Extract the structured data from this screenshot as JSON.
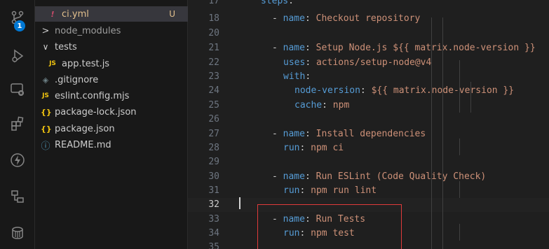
{
  "activity_bar": {
    "icons": [
      "source-control-icon",
      "run-debug-icon",
      "remote-explorer-icon",
      "extensions-icon",
      "deploy-icon",
      "timeline-icon",
      "database-icon"
    ],
    "source_control_badge": "1",
    "accent_color": "#0078d4"
  },
  "explorer": {
    "items": [
      {
        "icon": "!",
        "label": "ci.yml",
        "status": "U"
      },
      {
        "icon": ">",
        "label": "node_modules"
      },
      {
        "icon": "∨",
        "label": "tests"
      },
      {
        "icon": "JS",
        "label": "app.test.js"
      },
      {
        "icon": "◈",
        "label": ".gitignore"
      },
      {
        "icon": "JS",
        "label": "eslint.config.mjs"
      },
      {
        "icon": "{}",
        "label": "package-lock.json"
      },
      {
        "icon": "{}",
        "label": "package.json"
      },
      {
        "icon": "ⓘ",
        "label": "README.md"
      }
    ]
  },
  "editor": {
    "current_line": "32",
    "lines": [
      {
        "n": "17",
        "t": [
          {
            "c": "k",
            "s": "steps"
          },
          {
            "c": "p",
            "s": ":"
          }
        ]
      },
      {
        "n": "18",
        "t": [
          {
            "c": "p",
            "s": "- "
          },
          {
            "c": "k",
            "s": "name"
          },
          {
            "c": "p",
            "s": ": "
          },
          {
            "c": "v",
            "s": "Checkout repository"
          }
        ]
      },
      {
        "n": "20",
        "t": []
      },
      {
        "n": "21",
        "t": [
          {
            "c": "p",
            "s": "- "
          },
          {
            "c": "k",
            "s": "name"
          },
          {
            "c": "p",
            "s": ": "
          },
          {
            "c": "v",
            "s": "Setup Node.js ${{ matrix.node-version }}"
          }
        ]
      },
      {
        "n": "22",
        "t": [
          {
            "c": "k",
            "s": "uses"
          },
          {
            "c": "p",
            "s": ": "
          },
          {
            "c": "v",
            "s": "actions/setup-node@v4"
          }
        ]
      },
      {
        "n": "23",
        "t": [
          {
            "c": "k",
            "s": "with"
          },
          {
            "c": "p",
            "s": ":"
          }
        ]
      },
      {
        "n": "24",
        "t": [
          {
            "c": "k",
            "s": "node-version"
          },
          {
            "c": "p",
            "s": ": "
          },
          {
            "c": "v",
            "s": "${{ matrix.node-version }}"
          }
        ]
      },
      {
        "n": "25",
        "t": [
          {
            "c": "k",
            "s": "cache"
          },
          {
            "c": "p",
            "s": ": "
          },
          {
            "c": "v",
            "s": "npm"
          }
        ]
      },
      {
        "n": "26",
        "t": []
      },
      {
        "n": "27",
        "t": [
          {
            "c": "p",
            "s": "- "
          },
          {
            "c": "k",
            "s": "name"
          },
          {
            "c": "p",
            "s": ": "
          },
          {
            "c": "v",
            "s": "Install dependencies"
          }
        ]
      },
      {
        "n": "28",
        "t": [
          {
            "c": "k",
            "s": "run"
          },
          {
            "c": "p",
            "s": ": "
          },
          {
            "c": "v",
            "s": "npm ci"
          }
        ]
      },
      {
        "n": "29",
        "t": []
      },
      {
        "n": "30",
        "t": [
          {
            "c": "p",
            "s": "- "
          },
          {
            "c": "k",
            "s": "name"
          },
          {
            "c": "p",
            "s": ": "
          },
          {
            "c": "v",
            "s": "Run ESLint (Code Quality Check)"
          }
        ]
      },
      {
        "n": "31",
        "t": [
          {
            "c": "k",
            "s": "run"
          },
          {
            "c": "p",
            "s": ": "
          },
          {
            "c": "v",
            "s": "npm run lint"
          }
        ]
      },
      {
        "n": "32",
        "t": []
      },
      {
        "n": "33",
        "t": [
          {
            "c": "p",
            "s": "- "
          },
          {
            "c": "k",
            "s": "name"
          },
          {
            "c": "p",
            "s": ": "
          },
          {
            "c": "v",
            "s": "Run Tests"
          }
        ]
      },
      {
        "n": "34",
        "t": [
          {
            "c": "k",
            "s": "run"
          },
          {
            "c": "p",
            "s": ": "
          },
          {
            "c": "v",
            "s": "npm test"
          }
        ]
      },
      {
        "n": "35",
        "t": []
      }
    ]
  },
  "colors": {
    "key": "#569cd6",
    "value": "#ce9178",
    "annotation_box": "#e03b3b",
    "untracked": "#e2c08d"
  }
}
